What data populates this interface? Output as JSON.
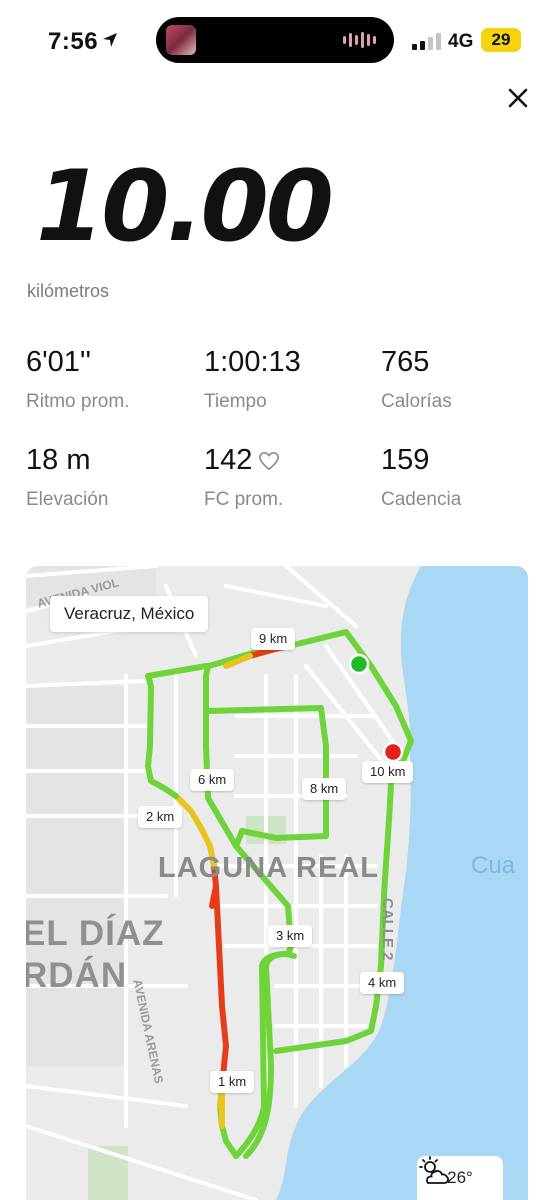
{
  "status": {
    "time": "7:56",
    "network": "4G",
    "battery": "29",
    "icons": [
      "location-arrow-icon",
      "signal-bars-icon",
      "battery-icon"
    ]
  },
  "close_icon": "close-icon",
  "summary": {
    "distance": "10.00",
    "distance_unit": "kilómetros"
  },
  "stats": [
    {
      "value": "6'01''",
      "label": "Ritmo prom."
    },
    {
      "value": "1:00:13",
      "label": "Tiempo"
    },
    {
      "value": "765",
      "label": "Calorías"
    },
    {
      "value": "18 m",
      "label": "Elevación"
    },
    {
      "value": "142",
      "label": "FC prom.",
      "icon": "heart-icon"
    },
    {
      "value": "159",
      "label": "Cadencia"
    }
  ],
  "map": {
    "place": "Veracruz, México",
    "neighborhood": "LAGUNA REAL",
    "area_left_1": "EL DÍAZ",
    "area_left_2": "RDÁN",
    "street_top": "AVENIDA VIOL",
    "street_avenue": "AVENIDA ARENAS",
    "street_calle": "CALLE 2",
    "lagoon": "Cua",
    "km_markers": [
      "1 km",
      "2 km",
      "3 km",
      "4 km",
      "6 km",
      "8 km",
      "9 km",
      "10 km"
    ],
    "start_color": "#22b829",
    "end_color": "#e81e1e",
    "route_colors": {
      "fast": "#6fd33a",
      "medium": "#e7c51e",
      "slow": "#e53d1c"
    },
    "water_color": "#a9d8f5"
  },
  "weather": {
    "temperature": "26°",
    "icon": "partly-cloudy-icon"
  }
}
